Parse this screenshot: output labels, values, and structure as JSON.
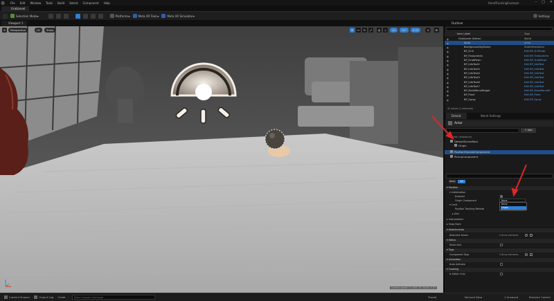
{
  "menu": {
    "items": [
      "File",
      "Edit",
      "Window",
      "Tools",
      "Build",
      "Select",
      "Component",
      "Help"
    ],
    "project": "HandTrackingExample"
  },
  "level_tab": "GrabLevel",
  "toolbar": {
    "selection_mode": "Selection Mode",
    "platforms": "Platforms",
    "meta_xr_tools": "Meta XR Tools",
    "meta_xr_simulator": "Meta XR Simulator",
    "settings": "Settings"
  },
  "viewport_tab": "Viewport 1",
  "viewport": {
    "perspective": "Perspective",
    "lit": "Lit",
    "show": "Show",
    "grid_snap": "10",
    "rot_snap": "10°",
    "scale_snap": "0.25",
    "cam_speed": "4",
    "status_text": "Camera speed: 4 | Grid: 10 | Scale: 0.25"
  },
  "outliner": {
    "title": "Outliner",
    "col_item": "Item Label",
    "col_type": "Type",
    "rows": [
      {
        "name": "GrabLevel (Editor)",
        "type": "World"
      },
      {
        "name": "Actor",
        "type": "Actor"
      },
      {
        "name": "BackgroundSkyDome",
        "type": "StaticMeshActor"
      },
      {
        "name": "BP_Grill",
        "type": "Edit BP_GrillGrab"
      },
      {
        "name": "BP_FeatureInfo",
        "type": "Edit BP_FeatureInfo"
      },
      {
        "name": "BP_GrabPawn",
        "type": "Edit BP_GrabPawn"
      },
      {
        "name": "BP_InfoText2",
        "type": "Edit BP_InfoText"
      },
      {
        "name": "BP_InfoText3",
        "type": "Edit BP_InfoText"
      },
      {
        "name": "BP_InfoText4",
        "type": "Edit BP_InfoText"
      },
      {
        "name": "BP_InfoText5",
        "type": "Edit BP_InfoText"
      },
      {
        "name": "BP_InfoText6",
        "type": "Edit BP_InfoText"
      },
      {
        "name": "BP_InfoText7",
        "type": "Edit BP_InfoText"
      },
      {
        "name": "BP_MainMenuWidget",
        "type": "Edit BP_MainMenuWi"
      },
      {
        "name": "BP_Plant",
        "type": "Edit BP_Plant"
      },
      {
        "name": "BP_Spray",
        "type": "Edit BP_Spray"
      }
    ],
    "footer": "42 actors (1 selected)"
  },
  "details": {
    "tab": "Details",
    "tab2": "World Settings",
    "actor_name": "Actor",
    "add_label": "Add",
    "components": [
      "Actor (Instance)",
      "DefaultSceneRoot",
      "Origin",
      "PositionTrackedComponent",
      "PickupComponent"
    ],
    "filter_tabs": [
      "Basic",
      "All"
    ],
    "sections": {
      "position": "Position",
      "initialization": "Initialization",
      "enabled": "Enabled",
      "origin_component": "Origin Component",
      "limit": "Limit",
      "position_tracking_method": "Position Tracking Method",
      "axis": "Axis",
      "interpolation": "Interpolation",
      "snap_back": "Snap Back",
      "attachments": "Attachments",
      "attached_actors": "Attached Actors",
      "editor": "Editor",
      "show_axis": "Show Axis",
      "tags": "Tags",
      "component_tags": "Component Tags",
      "activation": "Activation",
      "auto_activate": "Auto Activate",
      "cooking": "Cooking",
      "is_editor_only": "Is Editor Only",
      "array_elements": "0 Array elements"
    },
    "dropdown": {
      "selected": "None",
      "options": [
        "None",
        "Origin"
      ],
      "tracking_value": "Axis"
    }
  },
  "statusbar": {
    "content_drawer": "Content Drawer",
    "output_log": "Output Log",
    "cmd": "Cmd",
    "console_placeholder": "Enter Console Command",
    "trace": "Trace",
    "derived_data": "Derived Data",
    "unsaved": "1 Unsaved",
    "revision_control": "Revision Control"
  },
  "colors": {
    "accent": "#2f7fd4",
    "play": "#3aa447",
    "arrow": "#e0262a",
    "selected_row": "#1f4f8a",
    "link": "#5aa0e6"
  }
}
